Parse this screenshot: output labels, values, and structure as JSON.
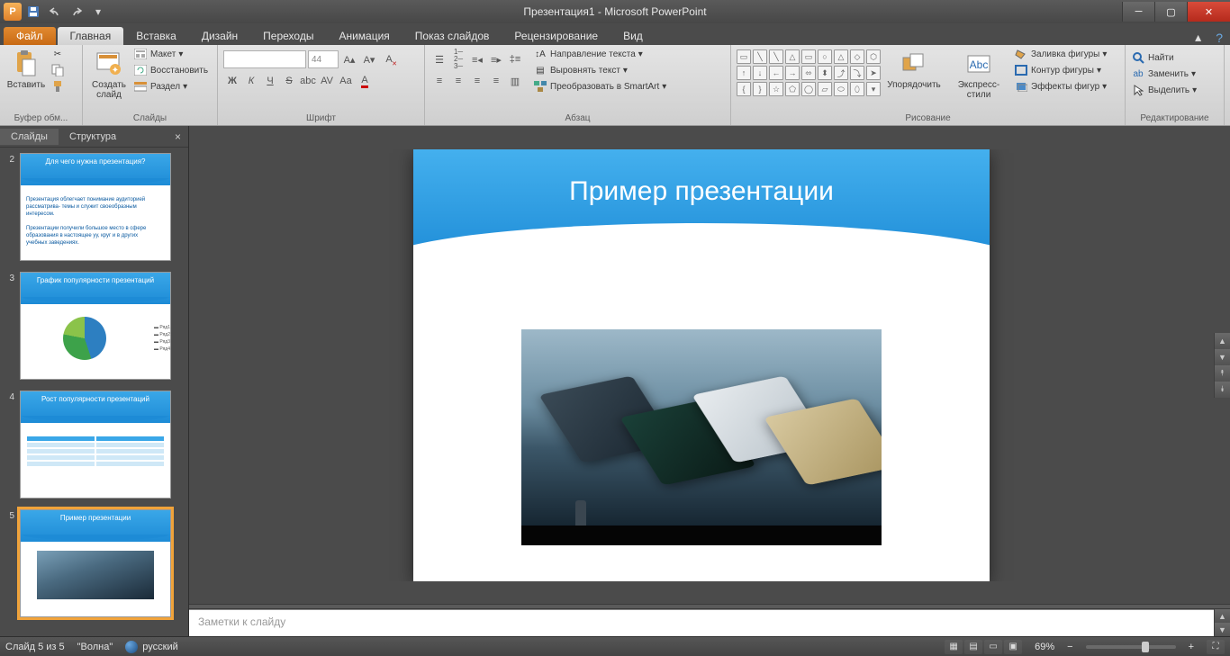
{
  "window": {
    "title": "Презентация1 - Microsoft PowerPoint"
  },
  "qat": {
    "app_letter": "P"
  },
  "tabs": {
    "file": "Файл",
    "items": [
      "Главная",
      "Вставка",
      "Дизайн",
      "Переходы",
      "Анимация",
      "Показ слайдов",
      "Рецензирование",
      "Вид"
    ],
    "active_index": 0
  },
  "ribbon": {
    "clipboard": {
      "label": "Буфер обм...",
      "paste": "Вставить"
    },
    "slides": {
      "label": "Слайды",
      "new_slide": "Создать\nслайд",
      "layout": "Макет",
      "reset": "Восстановить",
      "section": "Раздел"
    },
    "font": {
      "label": "Шрифт",
      "font_name": "",
      "font_size": "44"
    },
    "paragraph": {
      "label": "Абзац",
      "text_dir": "Направление текста",
      "align_text": "Выровнять текст",
      "smartart": "Преобразовать в SmartArt"
    },
    "drawing": {
      "label": "Рисование",
      "arrange": "Упорядочить",
      "styles": "Экспресс-стили",
      "fill": "Заливка фигуры",
      "outline": "Контур фигуры",
      "effects": "Эффекты фигур"
    },
    "editing": {
      "label": "Редактирование",
      "find": "Найти",
      "replace": "Заменить",
      "select": "Выделить"
    }
  },
  "sorter": {
    "tabs": {
      "slides": "Слайды",
      "outline": "Структура"
    },
    "thumbs": [
      {
        "num": "2",
        "title": "Для чего нужна презентация?"
      },
      {
        "num": "3",
        "title": "График популярности презентаций"
      },
      {
        "num": "4",
        "title": "Рост популярности презентаций"
      },
      {
        "num": "5",
        "title": "Пример презентации"
      }
    ]
  },
  "slide": {
    "title": "Пример презентации"
  },
  "notes": {
    "placeholder": "Заметки к слайду"
  },
  "status": {
    "slide_info": "Слайд 5 из 5",
    "theme": "\"Волна\"",
    "language": "русский",
    "zoom": "69%"
  }
}
